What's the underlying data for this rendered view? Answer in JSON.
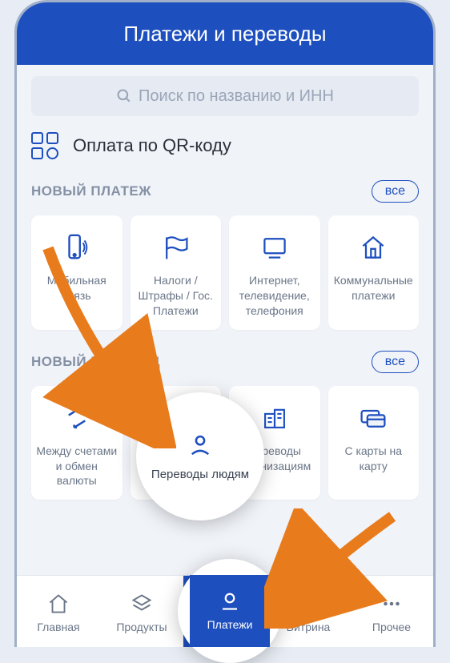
{
  "header": {
    "title": "Платежи и переводы"
  },
  "search": {
    "placeholder": "Поиск по названию и ИНН"
  },
  "qr": {
    "label": "Оплата по QR-коду"
  },
  "payment": {
    "title": "НОВЫЙ ПЛАТЕЖ",
    "all": "все",
    "tiles": [
      {
        "label": "Мобильная связь"
      },
      {
        "label": "Налоги / Штрафы / Гос. Платежи"
      },
      {
        "label": "Интернет, телевидение, телефония"
      },
      {
        "label": "Коммунальные платежи"
      }
    ]
  },
  "transfer": {
    "title": "НОВЫЙ ПЕРЕВОД",
    "all": "все",
    "tiles": [
      {
        "label": "Между счетами и обмен валюты"
      },
      {
        "label": "Переводы людям"
      },
      {
        "label": "Переводы организациям"
      },
      {
        "label": "С карты на карту"
      }
    ]
  },
  "nav": {
    "items": [
      {
        "label": "Главная"
      },
      {
        "label": "Продукты"
      },
      {
        "label": "Платежи"
      },
      {
        "label": "Витрина"
      },
      {
        "label": "Прочее"
      }
    ]
  }
}
